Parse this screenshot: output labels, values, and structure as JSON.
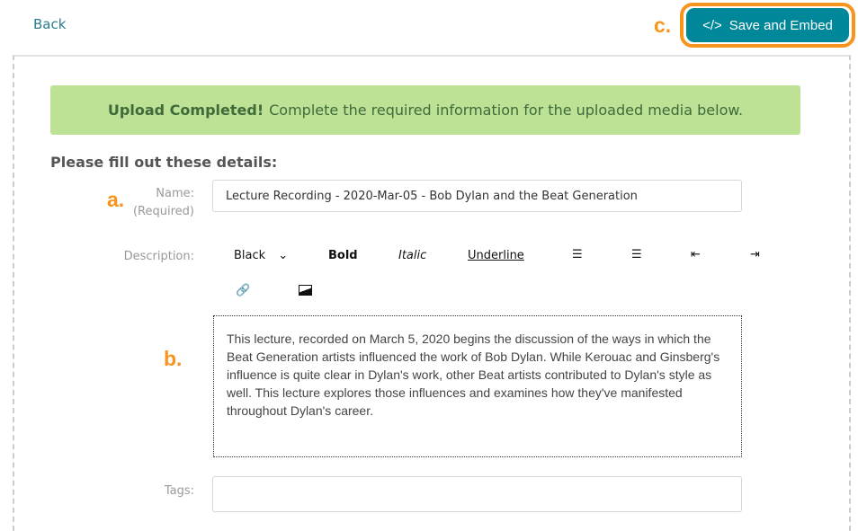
{
  "header": {
    "back_label": "Back",
    "save_label": "Save and Embed",
    "save_icon": "code-icon"
  },
  "annotations": {
    "a": "a.",
    "b": "b.",
    "c": "c."
  },
  "banner": {
    "strong": "Upload Completed!",
    "text": "Complete the required information for the uploaded media below.",
    "color": "#bde195"
  },
  "form": {
    "heading": "Please fill out these details:",
    "name_label": "Name:",
    "name_required": "(Required)",
    "name_value": "Lecture Recording - 2020-Mar-05 - Bob Dylan and the Beat Generation",
    "description_label": "Description:",
    "toolbar": {
      "color": "Black",
      "bold": "Bold",
      "italic": "Italic",
      "underline": "Underline"
    },
    "description_lines": [
      "This lecture, recorded on March 5, 2020 begins the discussion of the ways in which the",
      "Beat Generation artists influenced the work of Bob Dylan.  While Kerouac and Ginsberg's",
      "influence is quite clear in Dylan's work, other Beat artists contributed to Dylan's style as",
      "well.  This lecture explores those influences and examines how they've manifested",
      "throughout Dylan's career."
    ],
    "tags_label": "Tags:",
    "tags_value": ""
  },
  "colors": {
    "accent": "#00879a",
    "highlight": "#f7941d"
  }
}
